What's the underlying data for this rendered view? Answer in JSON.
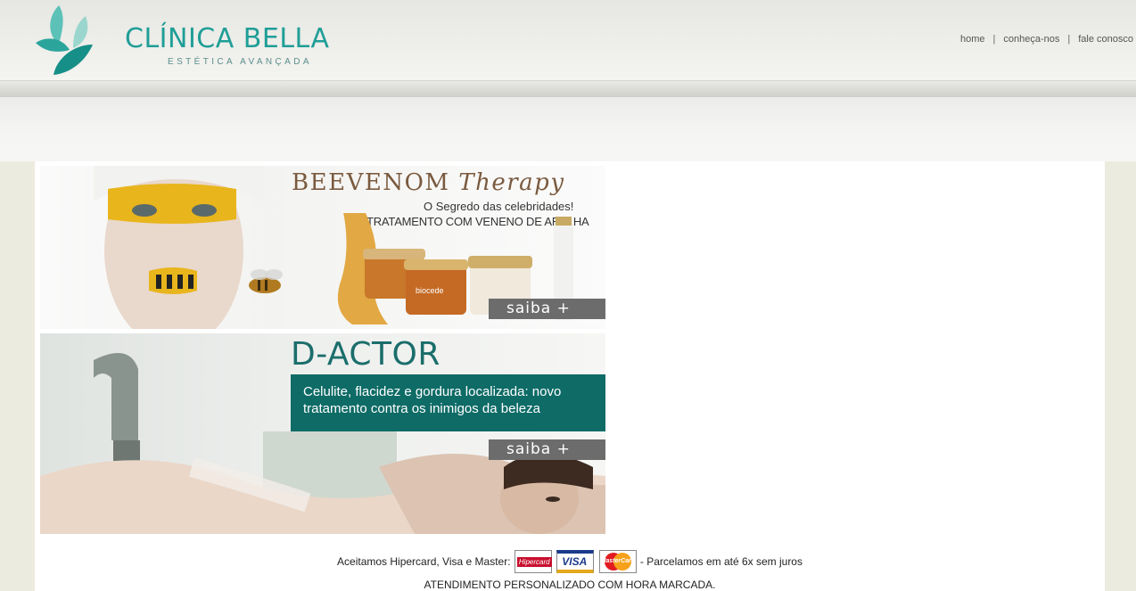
{
  "header": {
    "logo_title": "CLÍNICA BELLA",
    "logo_subtitle": "ESTÉTICA AVANÇADA",
    "nav": [
      {
        "label": "home"
      },
      {
        "label": "conheça-nos"
      },
      {
        "label": "fale conosco"
      }
    ],
    "nav_separator": "|"
  },
  "banners": [
    {
      "title": "BEEVENOM",
      "title_italic": "Therapy",
      "line1": "O Segredo das celebridades!",
      "line2": "TRATAMENTO COM VENENO DE ABELHA",
      "button": "saiba +",
      "brand": "biocede"
    },
    {
      "title": "D-ACTOR",
      "description": "Celulite, flacidez e gordura localizada: novo tratamento contra os inimigos da beleza",
      "button": "saiba +"
    }
  ],
  "footer": {
    "payments_prefix": "Aceitamos Hipercard, Visa e Master:",
    "payments_suffix": "- Parcelamos em até 6x sem juros",
    "cards": [
      "Hipercard",
      "VISA",
      "MasterCard"
    ],
    "appointment": "ATENDIMENTO PERSONALIZADO COM HORA MARCADA."
  },
  "colors": {
    "brand_teal": "#1f9e97",
    "dark_teal": "#0e6b66",
    "button_gray": "#6c6c6c",
    "side_beige": "#ecebdf"
  }
}
